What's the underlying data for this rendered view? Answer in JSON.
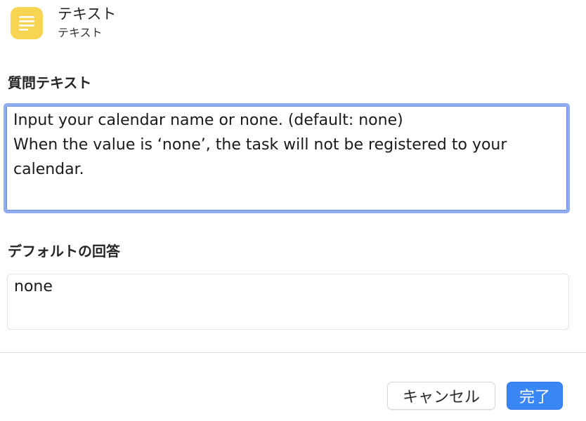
{
  "header": {
    "title": "テキスト",
    "subtitle": "テキスト",
    "icon": "text-lines-icon",
    "icon_color": "#f7d552"
  },
  "question": {
    "label": "質問テキスト",
    "value": "Input your calendar name or none. (default: none)\nWhen the value is ‘none’, the task will not be registered to your calendar.",
    "focus_color": "#8fadf0"
  },
  "default_answer": {
    "label": "デフォルトの回答",
    "value": "none"
  },
  "buttons": {
    "cancel_label": "キャンセル",
    "done_label": "完了",
    "done_color": "#3b86f5"
  }
}
